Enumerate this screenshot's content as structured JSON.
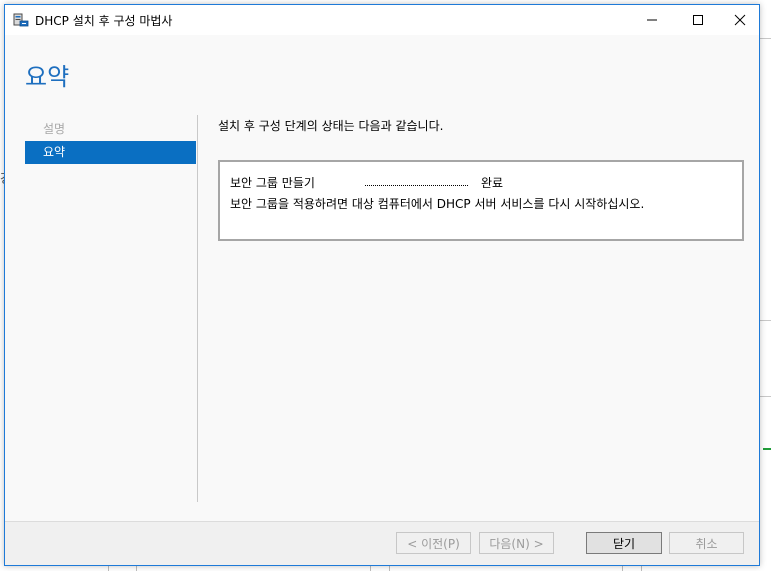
{
  "window": {
    "title": "DHCP 설치 후 구성 마법사",
    "controls": {
      "minimize_icon": "minimize-icon",
      "maximize_icon": "maximize-icon",
      "close_icon": "close-icon"
    }
  },
  "page": {
    "heading": "요약"
  },
  "nav": {
    "items": [
      {
        "label": "설명",
        "state": "disabled"
      },
      {
        "label": "요약",
        "state": "active"
      }
    ]
  },
  "content": {
    "intro": "설치 후 구성 단계의 상태는 다음과 같습니다.",
    "results": [
      {
        "name": "보안 그룹 만들기",
        "status": "완료"
      }
    ],
    "message": "보안 그룹을 적용하려면 대상 컴퓨터에서 DHCP 서버 서비스를 다시 시작하십시오."
  },
  "footer": {
    "prev_label": "< 이전(P)",
    "next_label": "다음(N) >",
    "close_label": "닫기",
    "cancel_label": "취소"
  },
  "colors": {
    "accent": "#0a6fc2",
    "heading": "#1e6fbf",
    "window_border": "#1e7ad8"
  }
}
